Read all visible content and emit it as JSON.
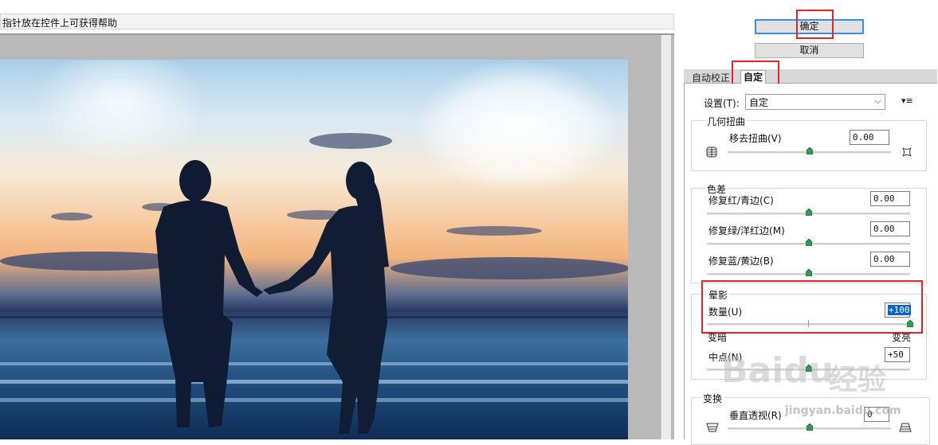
{
  "tip_bar": {
    "text": "指针放在控件上可获得帮助"
  },
  "buttons": {
    "ok_label": "确定",
    "cancel_label": "取消"
  },
  "tabs": [
    {
      "label": "自动校正"
    },
    {
      "label": "自定"
    }
  ],
  "settings": {
    "label": "设置(T):",
    "selected": "自定",
    "menu_icon": "▾≡"
  },
  "geometric_distortion": {
    "title": "几何扭曲",
    "remove_distortion": {
      "label": "移去扭曲(V)",
      "value": "0.00",
      "slider_fraction": 0.5
    }
  },
  "chromatic_aberration": {
    "title": "色差",
    "red_cyan": {
      "label": "修复红/青边(C)",
      "value": "0.00",
      "slider_fraction": 0.5
    },
    "green_magenta": {
      "label": "修复绿/洋红边(M)",
      "value": "0.00",
      "slider_fraction": 0.5
    },
    "blue_yellow": {
      "label": "修复蓝/黄边(B)",
      "value": "0.00",
      "slider_fraction": 0.5
    }
  },
  "vignette": {
    "title": "晕影",
    "amount": {
      "label": "数量(U)",
      "value": "+100",
      "slider_fraction": 1.0
    },
    "darken_label": "变暗",
    "lighten_label": "变亮",
    "midpoint": {
      "label": "中点(N)",
      "value": "+50",
      "slider_fraction": 0.5
    }
  },
  "transform": {
    "title": "变换",
    "vertical_perspective": {
      "label": "垂直透视(R)",
      "value": "0",
      "slider_fraction": 0.5
    }
  },
  "watermark": {
    "brand": "Baidu",
    "product": "经验",
    "url": "jingyan.baidu.com"
  },
  "colors": {
    "highlight_red": "#e0262a",
    "focus_blue": "#3c8ee0",
    "selection_blue": "#0a63c9",
    "knob_green": "#2e9a55"
  }
}
